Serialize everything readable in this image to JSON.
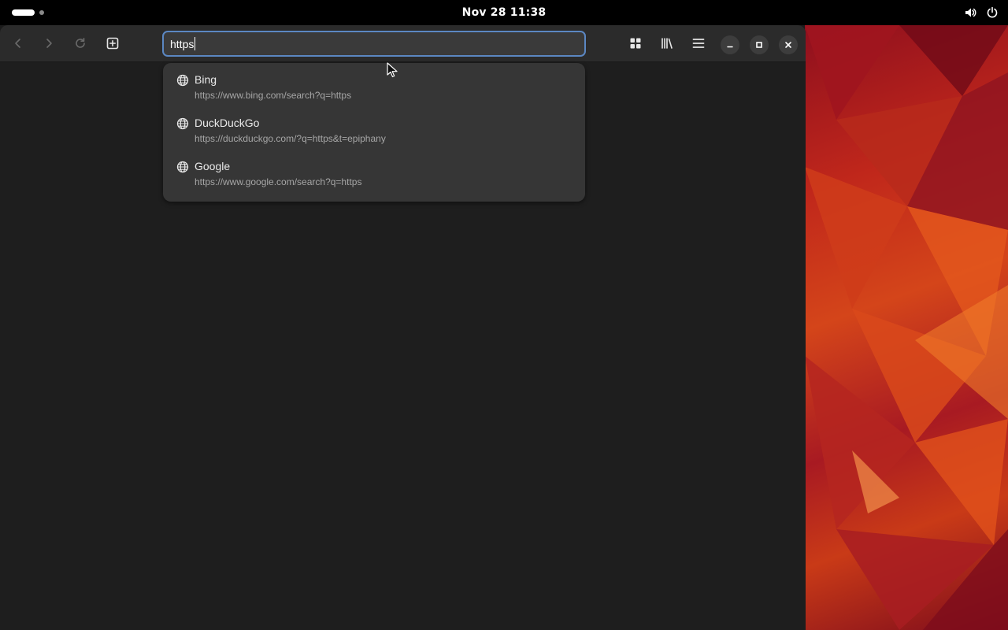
{
  "topbar": {
    "clock": "Nov 28  11:38"
  },
  "icons": {
    "back": "go-back-icon",
    "forward": "go-forward-icon",
    "reload": "reload-icon",
    "new_tab": "new-tab-icon",
    "overview": "tab-overview-icon",
    "library": "library-icon",
    "menu": "hamburger-menu-icon",
    "minimize": "minimize-icon",
    "maximize": "maximize-icon",
    "close": "close-icon",
    "volume": "volume-icon",
    "power": "power-icon",
    "globe": "globe-icon"
  },
  "browser": {
    "url_entry_value": "https",
    "suggestions": [
      {
        "title": "Bing",
        "url": "https://www.bing.com/search?q=https"
      },
      {
        "title": "DuckDuckGo",
        "url": "https://duckduckgo.com/?q=https&t=epiphany"
      },
      {
        "title": "Google",
        "url": "https://www.google.com/search?q=https"
      }
    ]
  },
  "colors": {
    "accent": "#5b87c2",
    "headerbar": "#2b2b2b",
    "popover": "#363636",
    "content": "#1e1e1e"
  }
}
